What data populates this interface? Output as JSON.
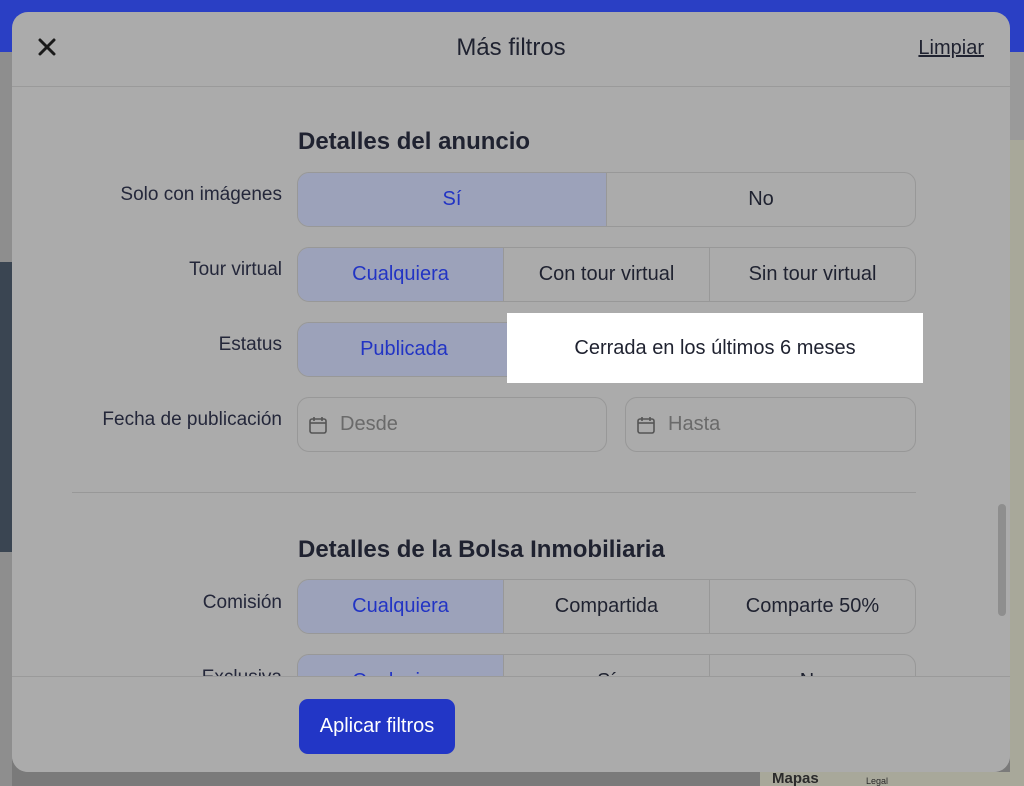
{
  "modal": {
    "title": "Más filtros",
    "clear_label": "Limpiar",
    "apply_label": "Aplicar filtros"
  },
  "sections": {
    "listing": {
      "title": "Detalles del anuncio",
      "images": {
        "label": "Solo con imágenes",
        "options": [
          "Sí",
          "No"
        ],
        "selected": "Sí"
      },
      "tour": {
        "label": "Tour virtual",
        "options": [
          "Cualquiera",
          "Con tour virtual",
          "Sin tour virtual"
        ],
        "selected": "Cualquiera"
      },
      "status": {
        "label": "Estatus",
        "options": [
          "Publicada",
          "Cerrada en los últimos 6 meses"
        ],
        "selected": "Publicada"
      },
      "date": {
        "label": "Fecha de publicación",
        "from_placeholder": "Desde",
        "to_placeholder": "Hasta"
      }
    },
    "mls": {
      "title": "Detalles de la Bolsa Inmobiliaria",
      "commission": {
        "label": "Comisión",
        "options": [
          "Cualquiera",
          "Compartida",
          "Comparte 50%"
        ],
        "selected": "Cualquiera"
      },
      "exclusive": {
        "label": "Exclusiva",
        "options": [
          "Cualquiera",
          "Sí",
          "No"
        ],
        "selected": "Cualquiera"
      }
    }
  },
  "background": {
    "maps_label": "Mapas",
    "legal_label": "Legal"
  },
  "icons": {
    "close": "close-icon",
    "calendar": "calendar-icon"
  },
  "colors": {
    "accent": "#2236c6",
    "selected_bg": "#9ca2ba",
    "selected_text": "#2234c4"
  }
}
